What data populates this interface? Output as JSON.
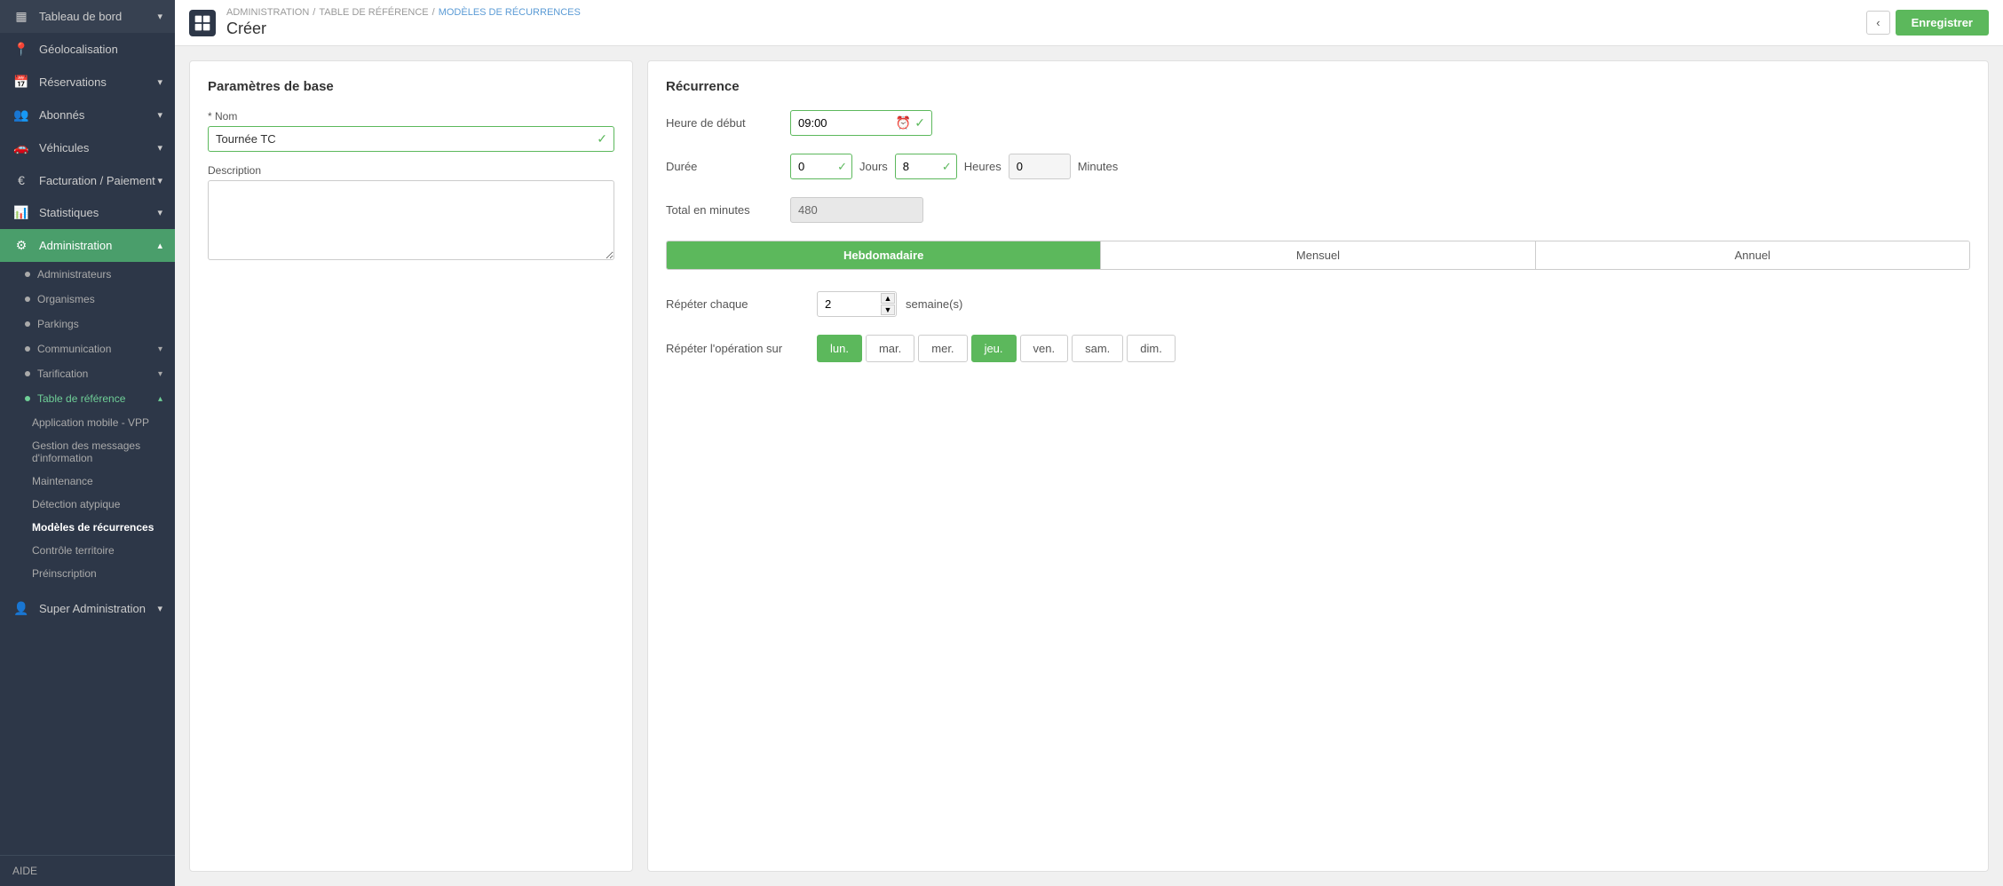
{
  "sidebar": {
    "items": [
      {
        "id": "tableau-de-bord",
        "label": "Tableau de bord",
        "icon": "📊",
        "hasChevron": true
      },
      {
        "id": "geolocalisation",
        "label": "Géolocalisation",
        "icon": "📍",
        "hasChevron": false
      },
      {
        "id": "reservations",
        "label": "Réservations",
        "icon": "📅",
        "hasChevron": true
      },
      {
        "id": "abonnes",
        "label": "Abonnés",
        "icon": "👥",
        "hasChevron": true
      },
      {
        "id": "vehicules",
        "label": "Véhicules",
        "icon": "🚗",
        "hasChevron": true
      },
      {
        "id": "facturation",
        "label": "Facturation / Paiement",
        "icon": "€",
        "hasChevron": true
      },
      {
        "id": "statistiques",
        "label": "Statistiques",
        "icon": "📊",
        "hasChevron": true
      },
      {
        "id": "administration",
        "label": "Administration",
        "icon": "⚙️",
        "hasChevron": true,
        "active": true
      }
    ],
    "admin_sub": [
      {
        "id": "administrateurs",
        "label": "Administrateurs",
        "active": false
      },
      {
        "id": "organismes",
        "label": "Organismes",
        "active": false
      },
      {
        "id": "parkings",
        "label": "Parkings",
        "active": false
      },
      {
        "id": "communication",
        "label": "Communication",
        "hasChevron": true
      },
      {
        "id": "tarification",
        "label": "Tarification",
        "hasChevron": true
      },
      {
        "id": "table-de-reference",
        "label": "Table de référence",
        "hasChevron": true,
        "active": true
      }
    ],
    "table_ref_items": [
      {
        "id": "application-mobile",
        "label": "Application mobile - VPP"
      },
      {
        "id": "gestion-messages",
        "label": "Gestion des messages d'information"
      },
      {
        "id": "maintenance",
        "label": "Maintenance"
      },
      {
        "id": "detection-atypique",
        "label": "Détection atypique"
      },
      {
        "id": "modeles-recurrences",
        "label": "Modèles de récurrences",
        "active": true
      },
      {
        "id": "controle-territoire",
        "label": "Contrôle territoire"
      },
      {
        "id": "preinscription",
        "label": "Préinscription"
      }
    ],
    "super_admin": "Super Administration",
    "aide": "AIDE"
  },
  "breadcrumb": {
    "parts": [
      "ADMINISTRATION",
      "TABLE DE RÉFÉRENCE",
      "MODÈLES DE RÉCURRENCES"
    ],
    "title": "Créer"
  },
  "topbar": {
    "back_label": "‹",
    "save_label": "Enregistrer"
  },
  "left_card": {
    "title": "Paramètres de base",
    "name_label": "* Nom",
    "name_value": "Tournée TC",
    "description_label": "Description",
    "description_placeholder": ""
  },
  "right_card": {
    "title": "Récurrence",
    "heure_debut_label": "Heure de début",
    "heure_debut_value": "09:00",
    "duree_label": "Durée",
    "duree_jours": "0",
    "jours_label": "Jours",
    "duree_heures": "8",
    "heures_label": "Heures",
    "duree_minutes": "0",
    "minutes_label": "Minutes",
    "total_label": "Total en minutes",
    "total_value": "480",
    "tabs": [
      "Hebdomadaire",
      "Mensuel",
      "Annuel"
    ],
    "active_tab": 0,
    "repeter_chaque_label": "Répéter chaque",
    "repeter_chaque_value": "2",
    "semaine_label": "semaine(s)",
    "repeter_operation_label": "Répéter l'opération sur",
    "days": [
      {
        "id": "lun",
        "label": "lun.",
        "active": true
      },
      {
        "id": "mar",
        "label": "mar.",
        "active": false
      },
      {
        "id": "mer",
        "label": "mer.",
        "active": false
      },
      {
        "id": "jeu",
        "label": "jeu.",
        "active": true
      },
      {
        "id": "ven",
        "label": "ven.",
        "active": false
      },
      {
        "id": "sam",
        "label": "sam.",
        "active": false
      },
      {
        "id": "dim",
        "label": "dim.",
        "active": false
      }
    ]
  },
  "colors": {
    "green": "#5cb85c",
    "sidebar_bg": "#2d3748",
    "sidebar_active": "#4a9e6b"
  }
}
